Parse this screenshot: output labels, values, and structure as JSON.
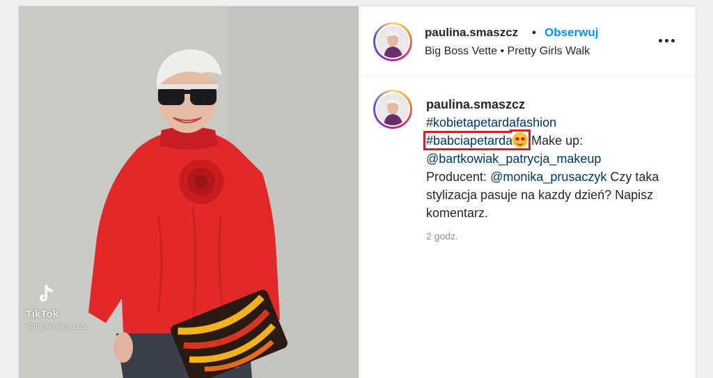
{
  "post": {
    "username": "paulina.smaszcz",
    "follow_label": "Obserwuj",
    "audio": "Big Boss Vette • Pretty Girls Walk",
    "more_icon": "more-options-icon"
  },
  "media": {
    "watermark_name": "TikTok",
    "watermark_handle": "@paulinasmaszcz"
  },
  "caption": {
    "username": "paulina.smaszcz",
    "hashtag1": "#kobietapetardafashion",
    "hashtag2": "#babciapetarda",
    "emoji_icon": "smiling-face-with-hearts-icon",
    "makeup_label": " Make up:",
    "mention1": "@bartkowiak_patrycja_makeup",
    "producer_label": "Producent: ",
    "mention2": "@monika_prusaczyk",
    "question": " Czy taka stylizacja pasuje na kazdy dzień? Napisz komentarz.",
    "timestamp": "2 godz."
  },
  "colors": {
    "follow_blue": "#0095f6",
    "link_blue": "#00376b",
    "highlight_red": "#d32027"
  }
}
